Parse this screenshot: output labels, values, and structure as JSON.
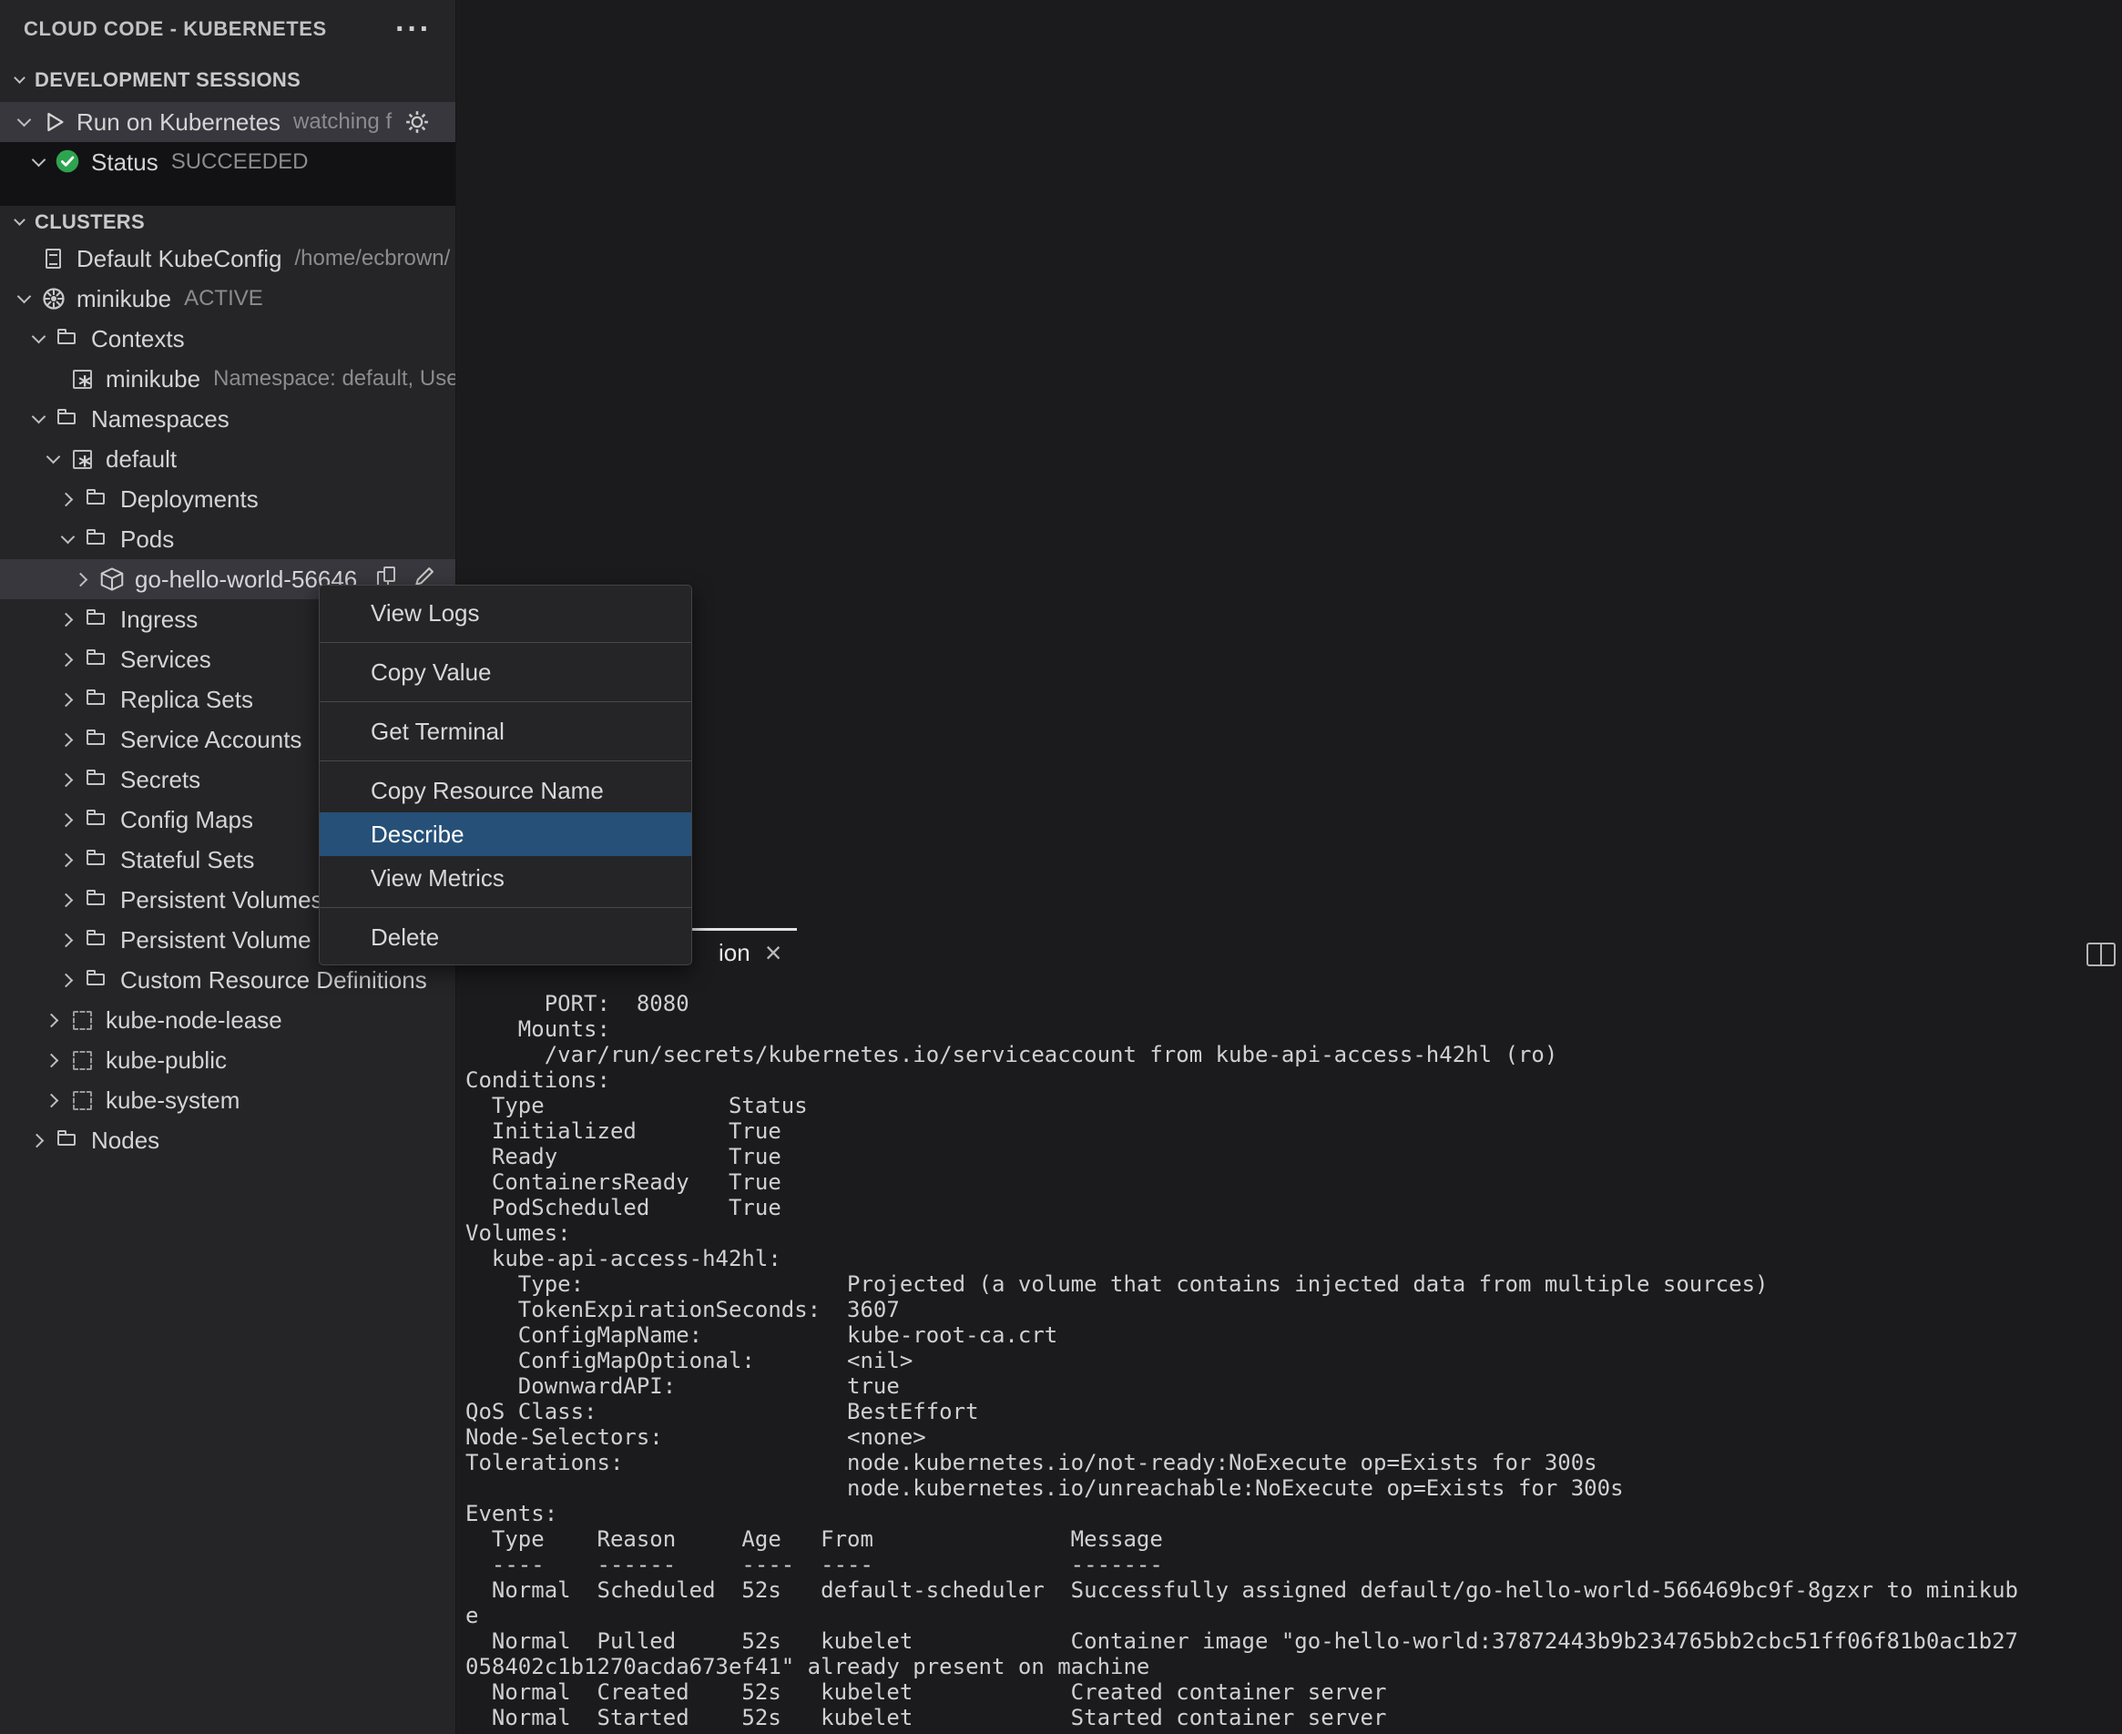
{
  "colors": {
    "menu_highlight": "#265078",
    "status_green": "#2ea44f",
    "selection_gray": "#37373d"
  },
  "sidebar": {
    "title": "CLOUD CODE - KUBERNETES",
    "dev_sessions": {
      "header": "DEVELOPMENT SESSIONS",
      "run": {
        "label": "Run on Kubernetes",
        "description": "watching f"
      },
      "status": {
        "label": "Status",
        "value": "SUCCEEDED"
      }
    },
    "clusters_header": "CLUSTERS",
    "tree": [
      {
        "label": "Default KubeConfig",
        "description": "/home/ecbrown/",
        "icon": "file-icon"
      },
      {
        "label": "minikube",
        "description": "ACTIVE",
        "icon": "k8s-wheel-icon"
      },
      {
        "label": "Contexts",
        "icon": "folder-icon"
      },
      {
        "label": "minikube",
        "description": "Namespace: default, Use",
        "icon": "star-square-icon"
      },
      {
        "label": "Namespaces",
        "icon": "folder-icon"
      },
      {
        "label": "default",
        "icon": "star-square-icon"
      },
      {
        "label": "Deployments",
        "icon": "folder-icon"
      },
      {
        "label": "Pods",
        "icon": "folder-icon"
      },
      {
        "label": "go-hello-world-56646",
        "icon": "pod-cube-icon"
      },
      {
        "label": "Ingress",
        "icon": "folder-icon"
      },
      {
        "label": "Services",
        "icon": "folder-icon"
      },
      {
        "label": "Replica Sets",
        "icon": "folder-icon"
      },
      {
        "label": "Service Accounts",
        "icon": "folder-icon"
      },
      {
        "label": "Secrets",
        "icon": "folder-icon"
      },
      {
        "label": "Config Maps",
        "icon": "folder-icon"
      },
      {
        "label": "Stateful Sets",
        "icon": "folder-icon"
      },
      {
        "label": "Persistent Volumes",
        "icon": "folder-icon"
      },
      {
        "label": "Persistent Volume",
        "icon": "folder-icon"
      },
      {
        "label": "Custom Resource Definitions",
        "icon": "folder-icon"
      },
      {
        "label": "kube-node-lease",
        "icon": "dashed-square-icon"
      },
      {
        "label": "kube-public",
        "icon": "dashed-square-icon"
      },
      {
        "label": "kube-system",
        "icon": "dashed-square-icon"
      },
      {
        "label": "Nodes",
        "icon": "folder-icon"
      }
    ]
  },
  "context_menu": {
    "items": [
      "View Logs",
      "Copy Value",
      "Get Terminal",
      "Copy Resource Name",
      "Describe",
      "View Metrics",
      "Delete"
    ],
    "highlighted": "Describe"
  },
  "panel": {
    "tab": {
      "visible_label": "ion",
      "close_glyph": "×"
    },
    "terminal_lines": [
      "      PORT:  8080",
      "    Mounts:",
      "      /var/run/secrets/kubernetes.io/serviceaccount from kube-api-access-h42hl (ro)",
      "Conditions:",
      "  Type              Status",
      "  Initialized       True",
      "  Ready             True",
      "  ContainersReady   True",
      "  PodScheduled      True",
      "Volumes:",
      "  kube-api-access-h42hl:",
      "    Type:                    Projected (a volume that contains injected data from multiple sources)",
      "    TokenExpirationSeconds:  3607",
      "    ConfigMapName:           kube-root-ca.crt",
      "    ConfigMapOptional:       <nil>",
      "    DownwardAPI:             true",
      "QoS Class:                   BestEffort",
      "Node-Selectors:              <none>",
      "Tolerations:                 node.kubernetes.io/not-ready:NoExecute op=Exists for 300s",
      "                             node.kubernetes.io/unreachable:NoExecute op=Exists for 300s",
      "Events:",
      "  Type    Reason     Age   From               Message",
      "  ----    ------     ----  ----               -------",
      "  Normal  Scheduled  52s   default-scheduler  Successfully assigned default/go-hello-world-566469bc9f-8gzxr to minikub",
      "e",
      "  Normal  Pulled     52s   kubelet            Container image \"go-hello-world:37872443b9b234765bb2cbc51ff06f81b0ac1b27",
      "058402c1b1270acda673ef41\" already present on machine",
      "  Normal  Created    52s   kubelet            Created container server",
      "  Normal  Started    52s   kubelet            Started container server"
    ]
  }
}
